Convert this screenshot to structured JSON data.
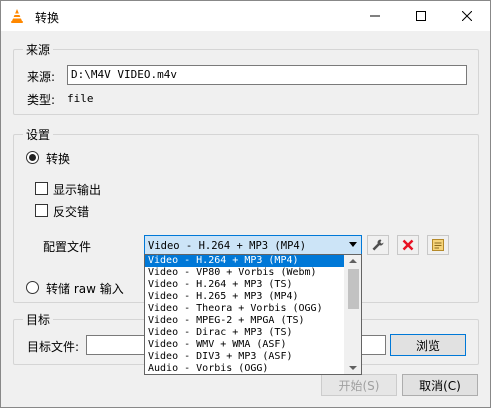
{
  "window": {
    "title": "转换",
    "minimize_glyph": "—",
    "maximize_glyph": "☐",
    "close_glyph": "✕"
  },
  "source": {
    "group_label": "来源",
    "source_label": "来源:",
    "source_value": "D:\\M4V VIDEO.m4v",
    "type_label": "类型:",
    "type_value": "file"
  },
  "settings": {
    "group_label": "设置",
    "convert_label": "转换",
    "show_output_label": "显示输出",
    "deinterlace_label": "反交错",
    "profile_label": "配置文件",
    "profile_selected": "Video - H.264 + MP3 (MP4)",
    "dump_raw_label": "转储 raw 输入",
    "profile_options": [
      "Video - H.264 + MP3 (MP4)",
      "Video - VP80 + Vorbis (Webm)",
      "Video - H.264 + MP3 (TS)",
      "Video - H.265 + MP3 (MP4)",
      "Video - Theora + Vorbis (OGG)",
      "Video - MPEG-2 + MPGA (TS)",
      "Video - Dirac + MP3 (TS)",
      "Video - WMV + WMA (ASF)",
      "Video - DIV3 + MP3 (ASF)",
      "Audio - Vorbis (OGG)"
    ]
  },
  "target": {
    "group_label": "目标",
    "file_label": "目标文件:",
    "file_value": "",
    "browse_label": "浏览"
  },
  "footer": {
    "start_label": "开始(S)",
    "cancel_label": "取消(C)"
  },
  "colors": {
    "accent": "#0078d7",
    "selection": "#cce4f7",
    "delete_red": "#e81123"
  }
}
